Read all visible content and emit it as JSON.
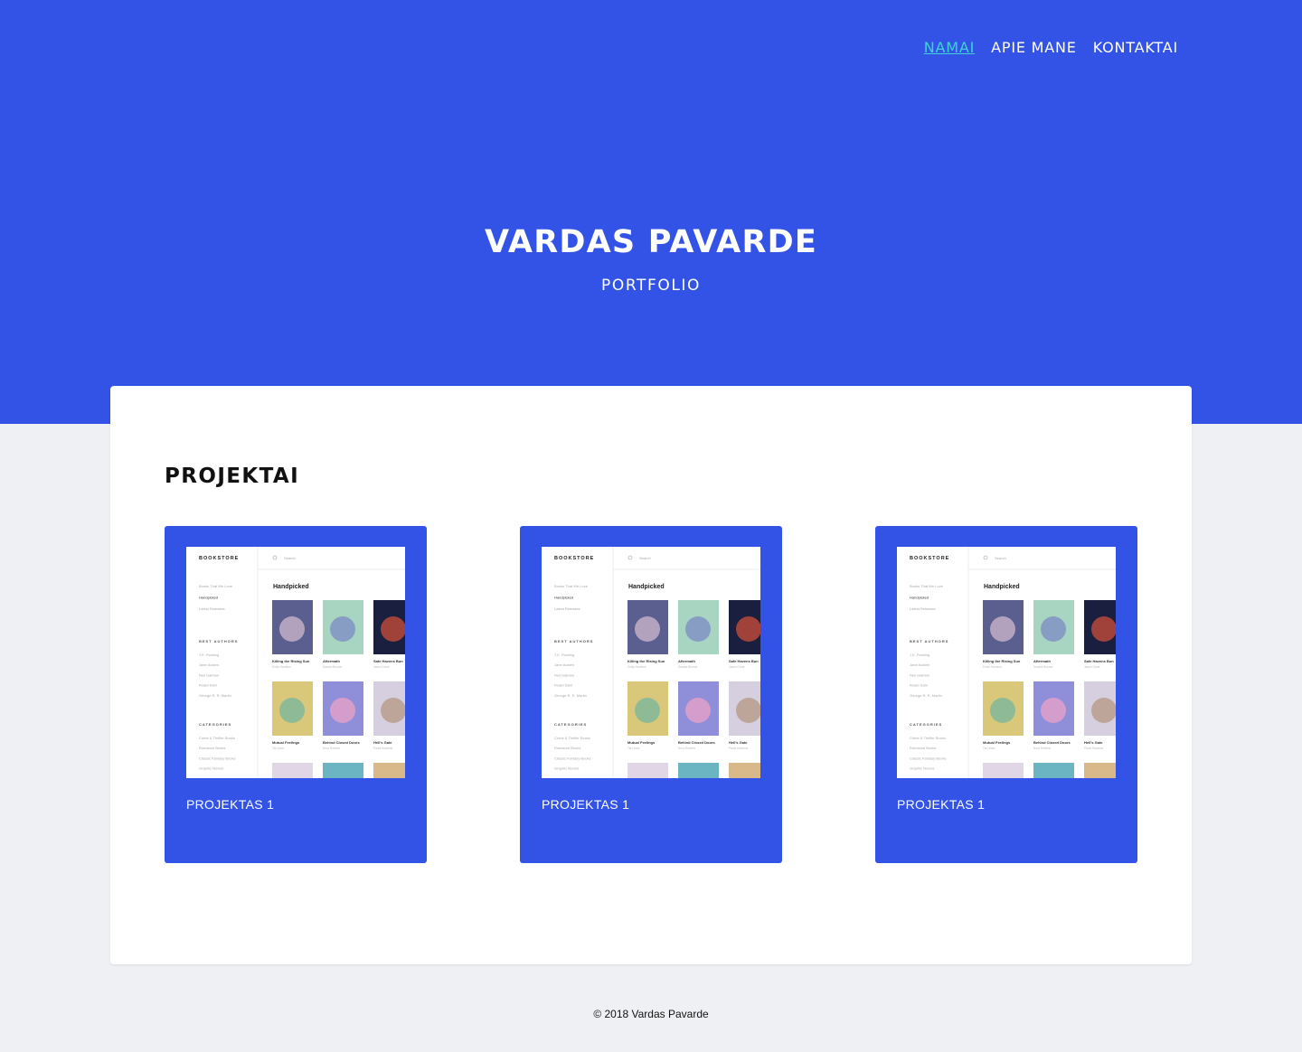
{
  "nav": {
    "items": [
      {
        "label": "NAMAI",
        "active": true
      },
      {
        "label": "APIE MANE",
        "active": false
      },
      {
        "label": "KONTAKTAI",
        "active": false
      }
    ]
  },
  "hero": {
    "title": "VARDAS PAVARDE",
    "subtitle": "PORTFOLIO"
  },
  "projects": {
    "title": "PROJEKTAI",
    "cards": [
      {
        "label": "PROJEKTAS 1"
      },
      {
        "label": "PROJEKTAS 1"
      },
      {
        "label": "PROJEKTAS 1"
      }
    ],
    "thumbnail": {
      "brand": "BOOKSTORE",
      "search_placeholder": "Search",
      "section_heading": "Handpicked",
      "sidebar_links": [
        "Books That We Love",
        "Handpicked",
        "Latest Releases"
      ],
      "authors_heading": "BEST AUTHORS",
      "authors": [
        "J.K. Rowling",
        "Jane Austen",
        "Neil Gaiman",
        "Roald Dahl",
        "George R. R. Martin"
      ],
      "categories_heading": "CATEGORIES",
      "categories": [
        "Crime & Thriller Books",
        "Romance Books",
        "Classic Fantasy Books",
        "Graphic Novels"
      ],
      "books": [
        {
          "title": "Killing the Rising Sun",
          "author": "Emily Harrison"
        },
        {
          "title": "Aftermath",
          "author": "Sandra Bourne"
        },
        {
          "title": "Safe Havens Bun",
          "author": "Jason Grant"
        },
        {
          "title": "Mutual Feelings",
          "author": "Tia Lewis"
        },
        {
          "title": "Behind Closed Doors",
          "author": "Nora Roberts"
        },
        {
          "title": "Hell's Gate",
          "author": "Paula Hawkins"
        }
      ]
    }
  },
  "footer": {
    "text": "© 2018 Vardas Pavarde"
  },
  "colors": {
    "primary": "#3353e6",
    "nav_active": "#3fd4d4",
    "background": "#eef0f3"
  }
}
